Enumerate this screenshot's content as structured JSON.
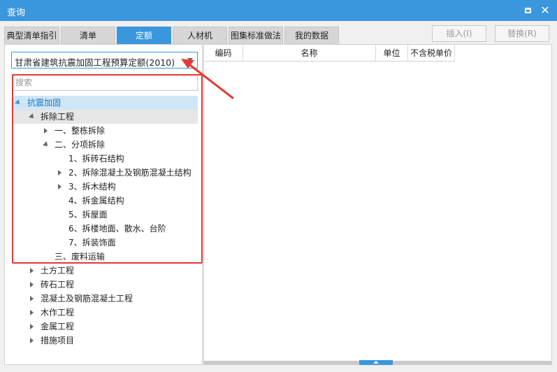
{
  "window": {
    "title": "查询"
  },
  "tabs": [
    "典型清单指引",
    "清单",
    "定额",
    "人材机",
    "图集标准做法",
    "我的数据"
  ],
  "toolbar": {
    "insert_label": "插入(I)",
    "replace_label": "替换(R)"
  },
  "quota_select": {
    "value": "甘肃省建筑抗震加固工程预算定额(2010)"
  },
  "search": {
    "placeholder": "搜索"
  },
  "tree": [
    "抗震加固",
    "拆除工程",
    "一、整栋拆除",
    "二、分项拆除",
    "1、拆砖石结构",
    "2、拆除混凝土及钢筋混凝土结构",
    "3、拆木结构",
    "4、拆金属结构",
    "5、拆屋面",
    "6、拆楼地面、散水、台阶",
    "7、拆装饰面",
    "三、废料运输",
    "土方工程",
    "砖石工程",
    "混凝土及钢筋混凝土工程",
    "木作工程",
    "金属工程",
    "措施项目"
  ],
  "table": {
    "columns": [
      "编码",
      "名称",
      "单位",
      "不含税单价"
    ]
  },
  "colors": {
    "accent": "#3a96dd",
    "annotation": "#e53935",
    "selection": "#cfe6f7"
  }
}
